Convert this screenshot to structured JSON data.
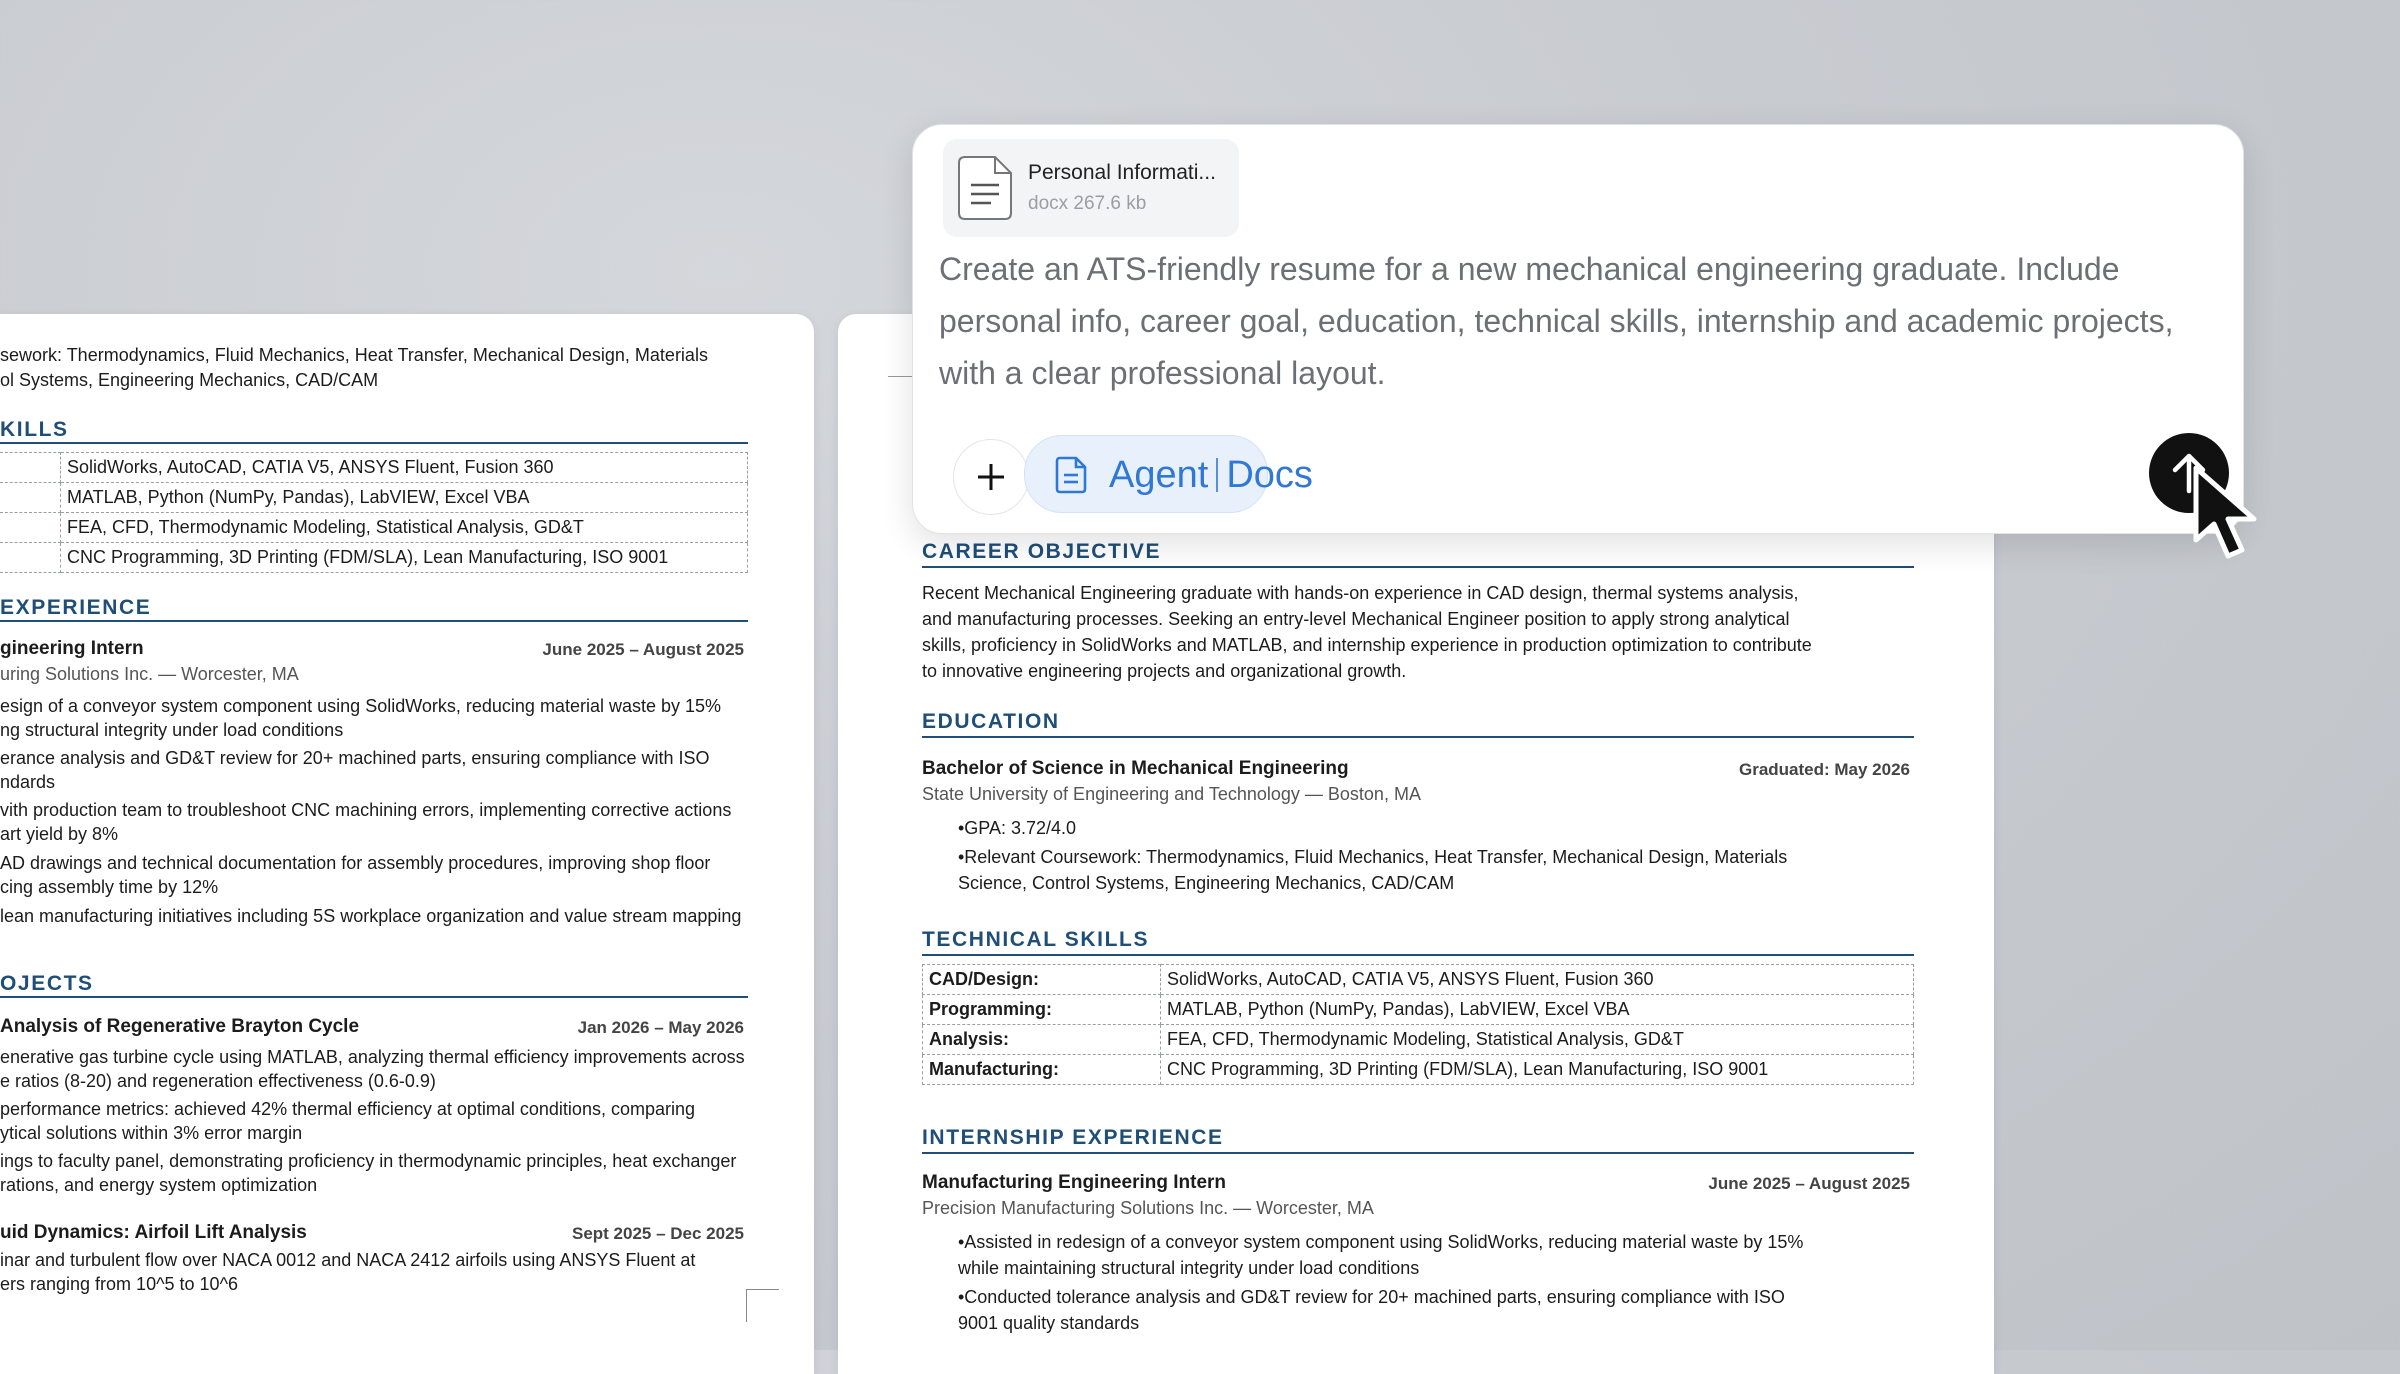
{
  "left_doc": {
    "coursework": [
      "sework: Thermodynamics, Fluid Mechanics, Heat Transfer, Mechanical Design, Materials",
      "ol Systems, Engineering Mechanics, CAD/CAM"
    ],
    "skills_title": "KILLS",
    "skills": [
      "SolidWorks, AutoCAD, CATIA V5, ANSYS Fluent, Fusion 360",
      "MATLAB, Python (NumPy, Pandas), LabVIEW, Excel VBA",
      "FEA, CFD, Thermodynamic Modeling, Statistical Analysis, GD&T",
      "CNC Programming, 3D Printing (FDM/SLA), Lean Manufacturing, ISO 9001"
    ],
    "exp_title": "EXPERIENCE",
    "job_title": "gineering Intern",
    "job_date": "June 2025 – August 2025",
    "job_company": "uring Solutions Inc. — Worcester, MA",
    "job_lines": [
      "esign of a conveyor system component using SolidWorks, reducing material waste by 15%",
      "ng structural integrity under load conditions",
      "erance analysis and GD&T review for 20+ machined parts, ensuring compliance with ISO",
      "ndards",
      "vith production team to troubleshoot CNC machining errors, implementing corrective actions",
      "art yield by 8%",
      "AD drawings and technical documentation for assembly procedures, improving shop floor",
      "cing assembly time by 12%",
      " lean manufacturing initiatives including 5S workplace organization and value stream mapping"
    ],
    "proj_title": "OJECTS",
    "proj1_title": "Analysis of Regenerative Brayton Cycle",
    "proj1_date": "Jan 2026 – May 2026",
    "proj1_lines": [
      "enerative gas turbine cycle using MATLAB, analyzing thermal efficiency improvements across",
      "e ratios (8-20) and regeneration effectiveness (0.6-0.9)",
      " performance metrics: achieved 42% thermal efficiency at optimal conditions, comparing",
      "ytical solutions within 3% error margin",
      "ings to faculty panel, demonstrating proficiency in thermodynamic principles, heat exchanger",
      "rations, and energy system optimization"
    ],
    "proj2_title": "uid Dynamics: Airfoil Lift Analysis",
    "proj2_date": "Sept 2025 – Dec 2025",
    "proj2_lines": [
      "inar and turbulent flow over NACA 0012 and NACA 2412 airfoils using ANSYS Fluent at",
      "ers ranging from 10^5 to 10^6"
    ]
  },
  "main_doc": {
    "objective_title": "CAREER OBJECTIVE",
    "objective_lines": [
      "Recent Mechanical Engineering graduate with hands-on experience in CAD design, thermal systems analysis,",
      "and manufacturing processes. Seeking an entry-level Mechanical Engineer position to apply strong analytical",
      "skills, proficiency in SolidWorks and MATLAB, and internship experience in production optimization to contribute",
      "to innovative engineering projects and organizational growth."
    ],
    "education_title": "EDUCATION",
    "degree": "Bachelor of Science in Mechanical Engineering",
    "grad_date": "Graduated: May 2026",
    "school": "State University of Engineering and Technology — Boston, MA",
    "edu_lines": [
      "•GPA: 3.72/4.0",
      "•Relevant Coursework: Thermodynamics, Fluid Mechanics, Heat Transfer, Mechanical Design, Materials",
      "Science, Control Systems, Engineering Mechanics, CAD/CAM"
    ],
    "skills_title": "TECHNICAL SKILLS",
    "skills": [
      {
        "k": "CAD/Design:",
        "v": "SolidWorks, AutoCAD, CATIA V5, ANSYS Fluent, Fusion 360"
      },
      {
        "k": "Programming:",
        "v": "MATLAB, Python (NumPy, Pandas), LabVIEW, Excel VBA"
      },
      {
        "k": "Analysis:",
        "v": "FEA, CFD, Thermodynamic Modeling, Statistical Analysis, GD&T"
      },
      {
        "k": "Manufacturing:",
        "v": "CNC Programming, 3D Printing (FDM/SLA), Lean Manufacturing, ISO 9001"
      }
    ],
    "internship_title": "INTERNSHIP EXPERIENCE",
    "job_title": "Manufacturing Engineering Intern",
    "job_date": "June 2025 – August 2025",
    "job_company": "Precision Manufacturing Solutions Inc. — Worcester, MA",
    "job_lines": [
      "•Assisted in redesign of a conveyor system component using SolidWorks, reducing material waste by 15%",
      "while maintaining structural integrity under load conditions",
      "•Conducted tolerance analysis and GD&T review for 20+ machined parts, ensuring compliance with ISO",
      "9001 quality standards"
    ]
  },
  "chat": {
    "file_name": "Personal Informati...",
    "file_meta": "docx 267.6 kb",
    "prompt": "Create an ATS-friendly resume for a new mechanical engineering graduate. Include personal info, career goal, education, technical skills, internship and academic projects, with a clear professional layout.",
    "agent_label": "Agent",
    "agent_mode": "Docs",
    "icons": {
      "file": "document-icon",
      "plus": "plus-icon",
      "agent": "doc-icon",
      "send": "arrow-up-icon",
      "cursor": "mouse-pointer-icon"
    }
  }
}
